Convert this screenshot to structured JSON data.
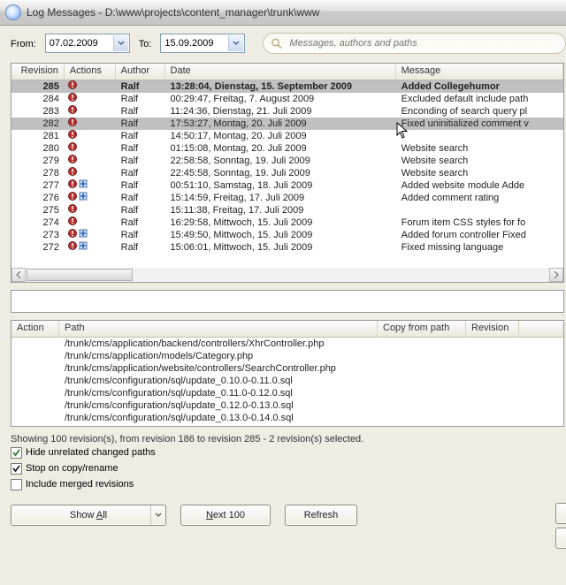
{
  "window_title": "Log Messages - D:\\www\\projects\\content_manager\\trunk\\www",
  "filter": {
    "from_label": "From:",
    "to_label": "To:",
    "from_date": "07.02.2009",
    "to_date": "15.09.2009",
    "search_placeholder": "Messages, authors and paths"
  },
  "log_columns": {
    "revision": "Revision",
    "actions": "Actions",
    "author": "Author",
    "date": "Date",
    "message": "Message"
  },
  "log_rows": [
    {
      "rev": "285",
      "actions": "m",
      "author": "Ralf",
      "date": "13:28:04, Dienstag, 15. September 2009",
      "msg": "Added Collegehumor",
      "sel": 1,
      "bold": true
    },
    {
      "rev": "284",
      "actions": "m",
      "author": "Ralf",
      "date": "00:29:47, Freitag, 7. August 2009",
      "msg": "Excluded default include path"
    },
    {
      "rev": "283",
      "actions": "m",
      "author": "Ralf",
      "date": "11:24:36, Dienstag, 21. Juli 2009",
      "msg": "Enconding of search query pl"
    },
    {
      "rev": "282",
      "actions": "m",
      "author": "Ralf",
      "date": "17:53:27, Montag, 20. Juli 2009",
      "msg": "Fixed uninitialized comment v",
      "sel": 1
    },
    {
      "rev": "281",
      "actions": "m",
      "author": "Ralf",
      "date": "14:50:17, Montag, 20. Juli 2009",
      "msg": ""
    },
    {
      "rev": "280",
      "actions": "m",
      "author": "Ralf",
      "date": "01:15:08, Montag, 20. Juli 2009",
      "msg": "Website search"
    },
    {
      "rev": "279",
      "actions": "m",
      "author": "Ralf",
      "date": "22:58:58, Sonntag, 19. Juli 2009",
      "msg": "Website search"
    },
    {
      "rev": "278",
      "actions": "m",
      "author": "Ralf",
      "date": "22:45:58, Sonntag, 19. Juli 2009",
      "msg": "Website search"
    },
    {
      "rev": "277",
      "actions": "ma",
      "author": "Ralf",
      "date": "00:51:10, Samstag, 18. Juli 2009",
      "msg": "Added website module Adde"
    },
    {
      "rev": "276",
      "actions": "ma",
      "author": "Ralf",
      "date": "15:14:59, Freitag, 17. Juli 2009",
      "msg": "Added comment rating"
    },
    {
      "rev": "275",
      "actions": "m",
      "author": "Ralf",
      "date": "15:11:38, Freitag, 17. Juli 2009",
      "msg": ""
    },
    {
      "rev": "274",
      "actions": "m",
      "author": "Ralf",
      "date": "16:29:58, Mittwoch, 15. Juli 2009",
      "msg": "Forum item CSS styles for fo"
    },
    {
      "rev": "273",
      "actions": "ma",
      "author": "Ralf",
      "date": "15:49:50, Mittwoch, 15. Juli 2009",
      "msg": "Added forum controller Fixed"
    },
    {
      "rev": "272",
      "actions": "ma",
      "author": "Ralf",
      "date": "15:06:01, Mittwoch, 15. Juli 2009",
      "msg": "Fixed missing language"
    }
  ],
  "path_columns": {
    "action": "Action",
    "path": "Path",
    "copy_from": "Copy from path",
    "revision": "Revision"
  },
  "path_rows": [
    {
      "path": "/trunk/cms/application/backend/controllers/XhrController.php"
    },
    {
      "path": "/trunk/cms/application/models/Category.php"
    },
    {
      "path": "/trunk/cms/application/website/controllers/SearchController.php"
    },
    {
      "path": "/trunk/cms/configuration/sql/update_0.10.0-0.11.0.sql"
    },
    {
      "path": "/trunk/cms/configuration/sql/update_0.11.0-0.12.0.sql"
    },
    {
      "path": "/trunk/cms/configuration/sql/update_0.12.0-0.13.0.sql"
    },
    {
      "path": "/trunk/cms/configuration/sql/update_0.13.0-0.14.0.sql"
    }
  ],
  "status_line": "Showing 100 revision(s), from revision 186 to revision 285 - 2 revision(s) selected.",
  "checkboxes": {
    "hide_unrelated": "Hide unrelated changed paths",
    "stop_on_copy": "Stop on copy/rename",
    "include_merged": "Include merged revisions"
  },
  "buttons": {
    "show_all_pre": "Show ",
    "show_all_u": "A",
    "show_all_post": "ll",
    "next_pre": "",
    "next_u": "N",
    "next_post": "ext 100",
    "refresh": "Refresh"
  }
}
